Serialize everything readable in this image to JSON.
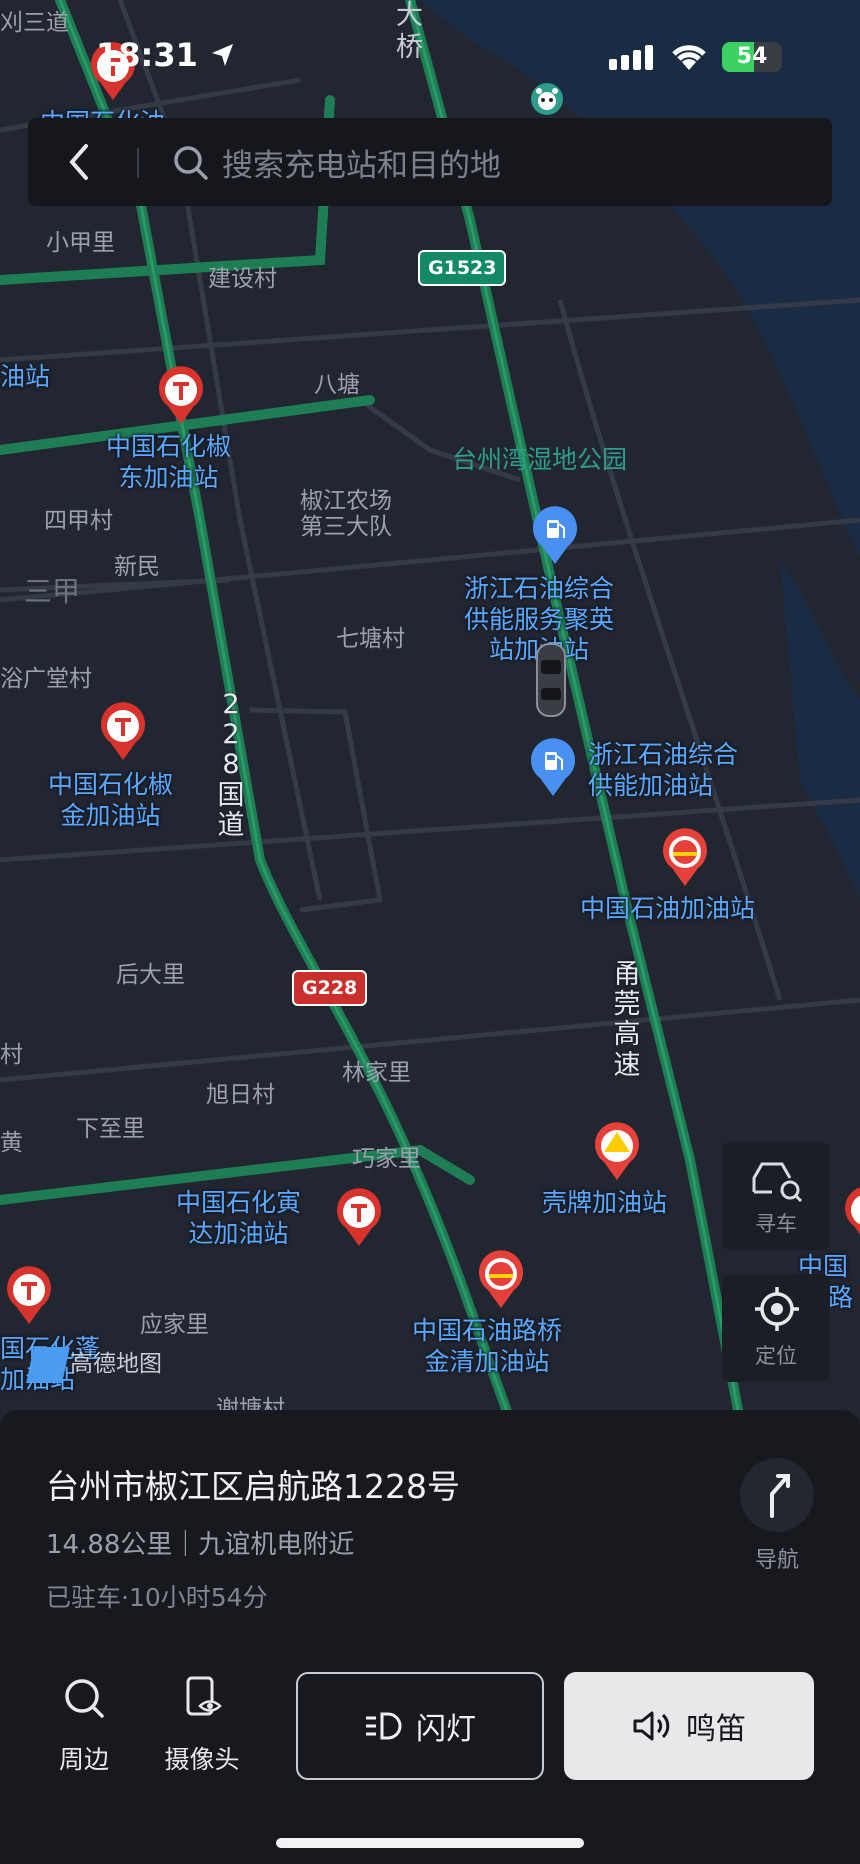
{
  "status_bar": {
    "time": "18:31",
    "battery": "54"
  },
  "search": {
    "placeholder": "搜索充电站和目的地"
  },
  "map": {
    "place_labels": [
      "刈三道",
      "小甲里",
      "建设村",
      "八塘",
      "四甲村",
      "新民",
      "三甲",
      "椒江农场",
      "第三大队",
      "七塘村",
      "浴广堂村",
      "后大里",
      "旭日村",
      "林家里",
      "下至里",
      "巧家里",
      "应家里",
      "村",
      "黄",
      "大",
      "桥",
      "油站",
      "谢塘村"
    ],
    "park_label": "台州湾湿地公园",
    "poi_labels": {
      "sinopec_jiao_dong": [
        "中国石化椒",
        "东加油站"
      ],
      "zhejiang_jubang": [
        "浙江石油综合",
        "供能服务聚英",
        "站加油站"
      ],
      "sinopec_jiao_jin": [
        "中国石化椒",
        "金加油站"
      ],
      "zhejiang_gongneng": [
        "浙江石油综合",
        "供能加油站"
      ],
      "petrochina": "中国石油加油站",
      "shell": "壳牌加油站",
      "sinopec_yinda": [
        "中国石化寅",
        "达加油站"
      ],
      "petrochina_luqiao": [
        "中国石油路桥",
        "金清加油站"
      ],
      "top_left_cut": "中国石化油",
      "right_cut": [
        "中国",
        "路"
      ],
      "bottom_left_cut": [
        "国石化蓬",
        "加油站"
      ]
    },
    "road_labels": {
      "g228_vertical": [
        "2",
        "2",
        "8",
        "国",
        "道"
      ],
      "yonggan": [
        "甬",
        "莞",
        "高",
        "速"
      ]
    },
    "shields": {
      "g1523": "G1523",
      "g228": "G228"
    },
    "watermark": "高德地图",
    "colors": {
      "sinopec": "#d8332c",
      "petrochina": "#e5413a",
      "shell": "#ffcc00",
      "poi_blue": "#4a90f0",
      "park": "#2d9c8a"
    }
  },
  "side_buttons": {
    "find_car": "寻车",
    "locate": "定位"
  },
  "sheet": {
    "address": "台州市椒江区启航路1228号",
    "distance": "14.88公里｜九谊机电附近",
    "parked": "已驻车·10小时54分",
    "nav_label": "导航",
    "actions": {
      "nearby": "周边",
      "camera": "摄像头",
      "flash": "闪灯",
      "horn": "鸣笛"
    }
  }
}
